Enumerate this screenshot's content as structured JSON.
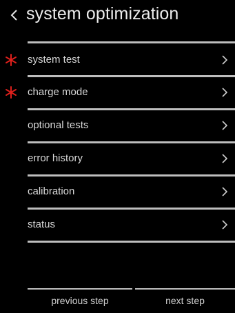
{
  "header": {
    "title": "system optimization",
    "back_icon": "chevron-left-icon"
  },
  "menu": {
    "items": [
      {
        "label": "system test",
        "required": true
      },
      {
        "label": "charge mode",
        "required": true
      },
      {
        "label": "optional tests",
        "required": false
      },
      {
        "label": "error history",
        "required": false
      },
      {
        "label": "calibration",
        "required": false
      },
      {
        "label": "status",
        "required": false
      }
    ],
    "required_marker_icon": "asterisk-icon",
    "chevron_icon": "chevron-right-icon"
  },
  "footer": {
    "previous_label": "previous step",
    "next_label": "next step"
  },
  "colors": {
    "background": "#000000",
    "text": "#d8d8d8",
    "divider": "#bdbdbd",
    "required_marker": "#e0201c"
  }
}
